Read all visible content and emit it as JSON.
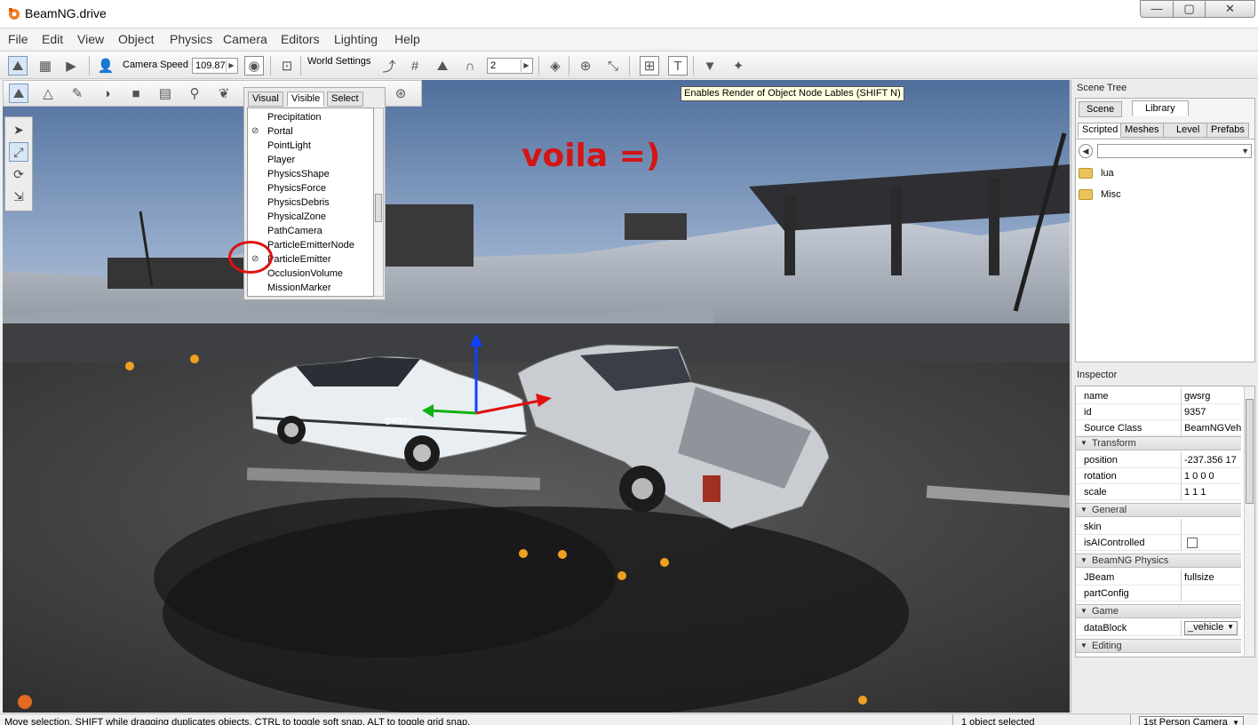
{
  "window": {
    "title": "BeamNG.drive",
    "controls": [
      "—",
      "▢",
      "✕"
    ]
  },
  "menu": [
    "File",
    "Edit",
    "View",
    "Object",
    "Physics",
    "Camera",
    "Editors",
    "Lighting",
    "Help"
  ],
  "toolbar": {
    "camera_speed_label": "Camera Speed",
    "camera_speed_value": "109.87",
    "world_settings_label": "World Settings",
    "snap_value": "2"
  },
  "tooltip": "Enables Render of Object Node Lables (SHIFT N)",
  "annotation": "voila =)",
  "visibility_popup": {
    "tabs": [
      "Visual",
      "Visible",
      "Select"
    ],
    "active_tab": "Visible",
    "items": [
      {
        "label": "Precipitation",
        "mark": ""
      },
      {
        "label": "Portal",
        "mark": "⊘"
      },
      {
        "label": "PointLight",
        "mark": ""
      },
      {
        "label": "Player",
        "mark": ""
      },
      {
        "label": "PhysicsShape",
        "mark": ""
      },
      {
        "label": "PhysicsForce",
        "mark": ""
      },
      {
        "label": "PhysicsDebris",
        "mark": ""
      },
      {
        "label": "PhysicalZone",
        "mark": ""
      },
      {
        "label": "PathCamera",
        "mark": ""
      },
      {
        "label": "ParticleEmitterNode",
        "mark": ""
      },
      {
        "label": "ParticleEmitter",
        "mark": "⊘"
      },
      {
        "label": "OcclusionVolume",
        "mark": ""
      },
      {
        "label": "MissionMarker",
        "mark": ""
      }
    ]
  },
  "scene_tree": {
    "title": "Scene Tree",
    "tabs": [
      "Scene",
      "Library"
    ],
    "active_tab": "Library",
    "library_tabs": [
      "Scripted",
      "Meshes",
      "Level",
      "Prefabs"
    ],
    "active_library_tab": "Scripted",
    "folders": [
      "lua",
      "Misc"
    ]
  },
  "inspector": {
    "title": "Inspector",
    "fields_top": [
      {
        "key": "name",
        "value": "gwsrg"
      },
      {
        "key": "id",
        "value": "9357"
      },
      {
        "key": "Source Class",
        "value": "BeamNGVeh"
      }
    ],
    "transform_label": "Transform",
    "transform": [
      {
        "key": "position",
        "value": "-237.356 17"
      },
      {
        "key": "rotation",
        "value": "1 0 0 0"
      },
      {
        "key": "scale",
        "value": "1 1 1"
      }
    ],
    "general_label": "General",
    "general": [
      {
        "key": "skin",
        "value": ""
      },
      {
        "key": "isAIControlled",
        "value": ""
      }
    ],
    "physics_label": "BeamNG Physics",
    "physics": [
      {
        "key": "JBeam",
        "value": "fullsize"
      },
      {
        "key": "partConfig",
        "value": ""
      }
    ],
    "game_label": "Game",
    "game": [
      {
        "key": "dataBlock",
        "value": "_vehicle"
      }
    ],
    "editing_label": "Editing",
    "isAIControlled_checked": false
  },
  "status": {
    "message": "Move selection.  SHIFT while dragging duplicates objects.  CTRL to toggle soft snap.  ALT to toggle grid snap.",
    "selection": "1 object selected",
    "camera_mode": "1st Person Camera"
  },
  "vehicle_label": "gwsrg",
  "colors": {
    "accent_red": "#d41515",
    "sky": "#6b8ab3",
    "ground": "#3a3a3a"
  }
}
